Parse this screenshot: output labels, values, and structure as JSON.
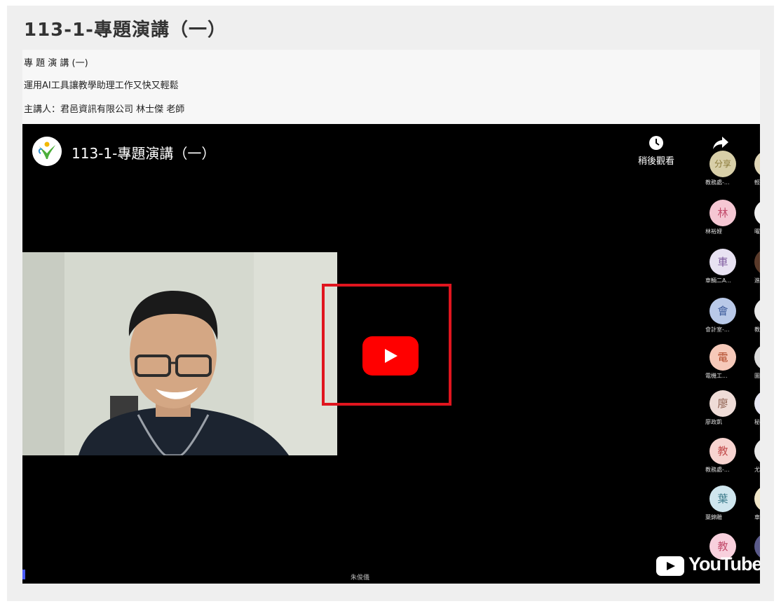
{
  "page": {
    "title": "113-1-專題演講（一）"
  },
  "info": {
    "lines": [
      "專 題 演 講 (一)",
      "運用AI工具讓教學助理工作又快又輕鬆",
      "主講人：君邑資訊有限公司 林士傑  老師"
    ]
  },
  "video": {
    "title": "113-1-專題演講（一）",
    "watch_later_label": "稍後觀看",
    "share_label": "",
    "brand": "YouTube",
    "bottom_name": "朱俊儀",
    "participants": [
      {
        "avatar": "分享",
        "name": "教務處-..."
      },
      {
        "avatar": "林",
        "name": "林裕娌"
      },
      {
        "avatar": "車",
        "name": "車輛二A..."
      },
      {
        "avatar": "會",
        "name": "會計室-..."
      },
      {
        "avatar": "電",
        "name": "電機工..."
      },
      {
        "avatar": "廖",
        "name": "廖政凱"
      },
      {
        "avatar": "教",
        "name": "教務處-..."
      },
      {
        "avatar": "葉",
        "name": "葉錦雕"
      },
      {
        "avatar": "教",
        "name": ""
      }
    ],
    "right_column_names": [
      "輕",
      "曜",
      "進",
      "教",
      "圖",
      "秘",
      "尤",
      "車",
      ""
    ],
    "colors": {
      "avatar_bgs": [
        "#d8cfa8",
        "#f5c7d3",
        "#e8e2f2",
        "#b9c9e8",
        "#f6c9b9",
        "#efdcd7",
        "#f7d4d0",
        "#cfe6ee",
        "#f8d0dd"
      ],
      "avatar_fgs": [
        "#8a7a3a",
        "#c24a6a",
        "#7e5a9e",
        "#3c5a9a",
        "#b24a2a",
        "#8a5a4a",
        "#c24a4a",
        "#3a7a8a",
        "#c24a6a"
      ],
      "play_red": "#ff0000",
      "highlight_red": "#e0151e"
    }
  }
}
